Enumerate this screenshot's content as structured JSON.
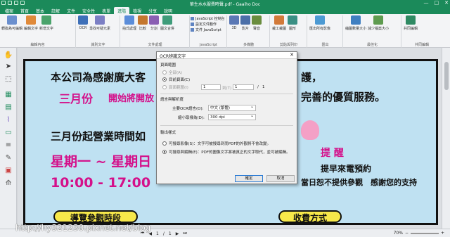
{
  "titlebar": {
    "title": "華生水水服費時聲.pdf - Gaaiho Doc",
    "controls": [
      "—",
      "□",
      "✕"
    ]
  },
  "menu": {
    "tabs": [
      "檔案",
      "首頁",
      "基本",
      "註解",
      "文件",
      "安全性",
      "表單",
      "進階",
      "檢視",
      "分享",
      "說明"
    ],
    "active_index": 7
  },
  "ribbon": {
    "groups": [
      {
        "label": "編輯內容",
        "buttons": [
          "轉換為可編輯",
          "編輯文字",
          "新增文字"
        ]
      },
      {
        "label": "識別文字",
        "buttons": [
          "OCR",
          "尋找可疑元素"
        ]
      },
      {
        "label": "文件處理",
        "buttons": [
          "拍式處理",
          "比較",
          "分割",
          "圖文合併"
        ]
      },
      {
        "label": "JavaScript",
        "buttons": [
          "JavaScript 控制台",
          "設定文件動作",
          "文件 JavaScript"
        ]
      },
      {
        "label": "多媒體",
        "buttons": [
          "3D",
          "影片",
          "聲音"
        ]
      },
      {
        "label": "剪貼與列印",
        "buttons": [
          "裁工裁圖",
          "圖形"
        ]
      },
      {
        "label": "匯出",
        "buttons": [
          "匯出所有影像"
        ]
      },
      {
        "label": "最佳化",
        "buttons": [
          "縮圖數量大小",
          "減少檔案大小"
        ]
      },
      {
        "label": "共同編輯",
        "buttons": [
          "共同編輯"
        ]
      }
    ]
  },
  "document": {
    "line1": "本公司為感謝廣大客",
    "line1_right": "護，",
    "line2": "三月份",
    "line2b": "開始將開放",
    "line2_right": "完善的優質服務。",
    "line3": "三月份起營業時間如",
    "line4": "星期一 ~ 星期日",
    "line5": "10:00 - 17:00",
    "right_red": "提 醒",
    "right_black1": "提早來電預約",
    "right_black2": "當日恕不提供參觀　感謝您的支持",
    "banner_left": "導覽參觀時段",
    "banner_right": "收費方式"
  },
  "pagenav": {
    "current": "1",
    "total": "1",
    "zoom": "70%"
  },
  "watermark": "http://hy321230.pixnet.net/blog",
  "dialog": {
    "title": "OCR辨識文字",
    "page_range_label": "頁面範圍",
    "opt_all": "全部(A)",
    "opt_current": "目前頁面(C)",
    "opt_pages": "頁面範圍(I)",
    "from_value": "1",
    "to_label": "到(T)",
    "to_value": "1",
    "of_label": "/",
    "of_value": "1",
    "lang_section": "語言與解析度",
    "lang_label": "主要OCR語言(O):",
    "lang_value": "中文 (繁體)",
    "res_label": "縮小取樣為(D):",
    "res_value": "300 dpi",
    "output_section": "輸出樣式",
    "out_opt1": "可搜尋影像(S)：文字可被搜尋到而PDF的外觀將不會改變。",
    "out_opt2": "可搜尋與編輯(E)：PDF的圖像文字將被真正的文字取代，並可被編輯。",
    "ok_label": "確定",
    "cancel_label": "取消"
  }
}
